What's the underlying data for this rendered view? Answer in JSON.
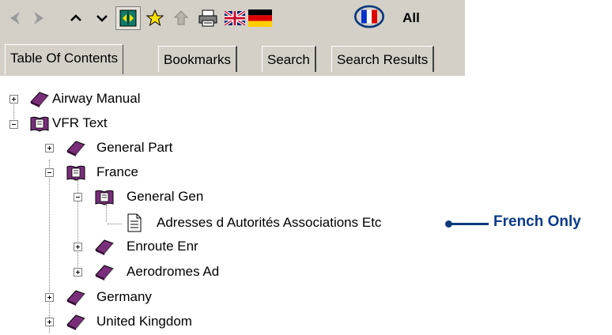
{
  "toolbar": {
    "all_label": "All"
  },
  "tabs": [
    {
      "label": "Table Of Contents"
    },
    {
      "label": "Bookmarks"
    },
    {
      "label": "Search"
    },
    {
      "label": "Search Results"
    }
  ],
  "tree": {
    "airway_manual": "Airway Manual",
    "vfr_text": "VFR Text",
    "general_part": "General Part",
    "france": "France",
    "general_gen": "General Gen",
    "adresses": "Adresses d Autorités Associations Etc",
    "enroute_enr": "Enroute Enr",
    "aerodromes_ad": "Aerodromes Ad",
    "germany": "Germany",
    "united_kingdom": "United Kingdom"
  },
  "callout": {
    "text": "French Only"
  },
  "colors": {
    "toolbar_bg": "#d4d0c8",
    "book_purple": "#6b2a6b",
    "callout_blue": "#0a3a8c"
  }
}
